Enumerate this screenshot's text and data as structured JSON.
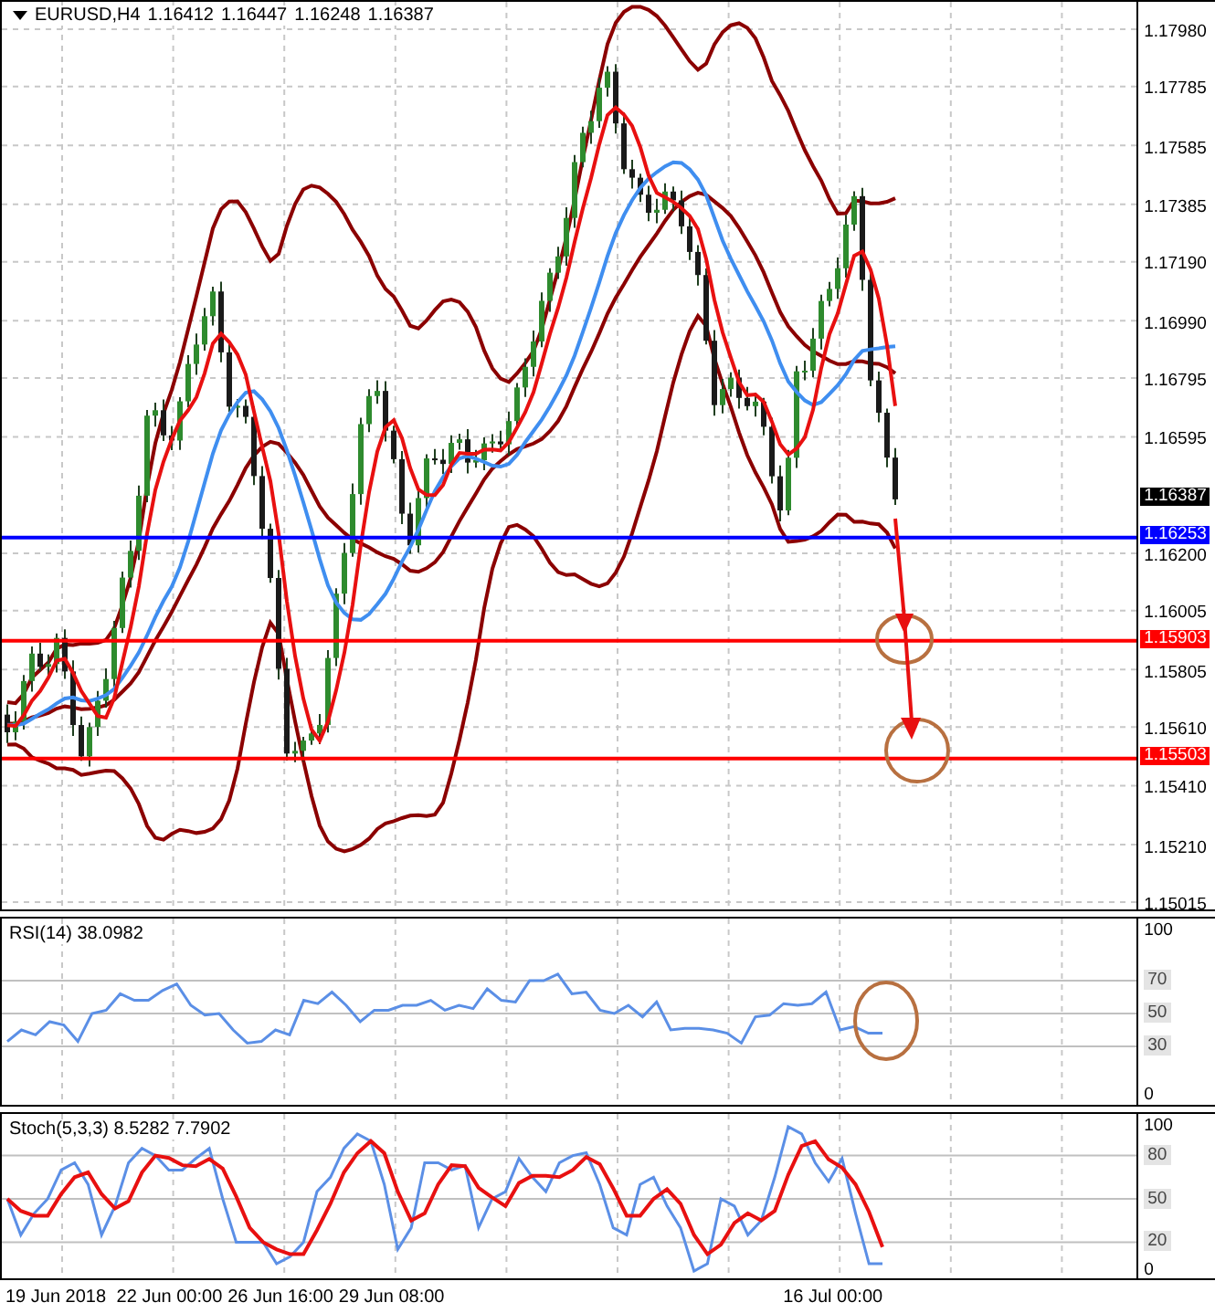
{
  "chart": {
    "symbol": "EURUSD,H4",
    "quote": [
      "1.16412",
      "1.16447",
      "1.16248",
      "1.16387"
    ],
    "current_price": "1.16387",
    "price_axis": [
      "1.17980",
      "1.17785",
      "1.17585",
      "1.17385",
      "1.17190",
      "1.16990",
      "1.16795",
      "1.16595",
      "1.16200",
      "1.16005",
      "1.15805",
      "1.15610",
      "1.15410",
      "1.15210",
      "1.15015"
    ],
    "levels": [
      {
        "price": "1.16253",
        "color": "#0000ff"
      },
      {
        "price": "1.15903",
        "color": "#ff0000"
      },
      {
        "price": "1.15503",
        "color": "#ff0000"
      }
    ]
  },
  "rsi": {
    "title": "RSI(14) 38.0982",
    "axis": [
      {
        "label": "100",
        "boxed": false
      },
      {
        "label": "70",
        "boxed": true
      },
      {
        "label": "50",
        "boxed": true
      },
      {
        "label": "30",
        "boxed": true
      },
      {
        "label": "0",
        "boxed": false
      }
    ]
  },
  "stochastic": {
    "title": "Stoch(5,3,3) 8.5282 7.7902",
    "axis": [
      {
        "label": "100",
        "boxed": false
      },
      {
        "label": "80",
        "boxed": true
      },
      {
        "label": "50",
        "boxed": true
      },
      {
        "label": "20",
        "boxed": true
      },
      {
        "label": "0",
        "boxed": false
      }
    ]
  },
  "time_axis": [
    "19 Jun 2018",
    "22 Jun 00:00",
    "26 Jun 16:00",
    "29 Jun 08:00",
    "16 Jul 00:00"
  ]
}
